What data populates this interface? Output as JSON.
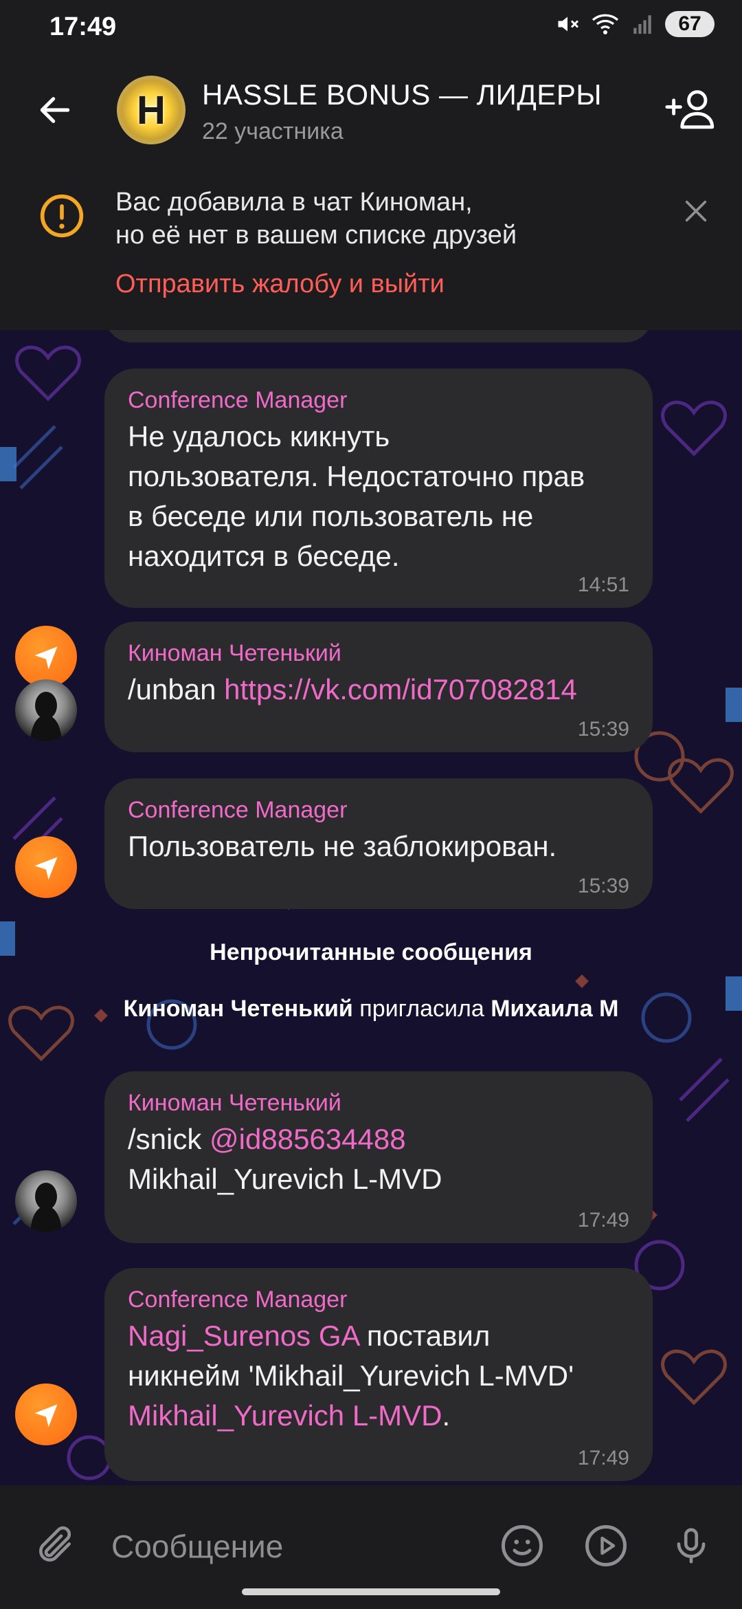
{
  "status_bar": {
    "time": "17:49",
    "battery": "67"
  },
  "header": {
    "title": "HASSLE BONUS — ЛИДЕРЫ",
    "subtitle": "22 участника",
    "avatar_letter": "H"
  },
  "notice": {
    "line1": "Вас добавила в чат Киноман,",
    "line2": "но её нет в вашем списке друзей",
    "action": "Отправить жалобу и выйти"
  },
  "messages": [
    {
      "sender": "Conference Manager",
      "lines": [
        "Не удалось кикнуть",
        "пользователя. Недостаточно прав",
        "в беседе или пользователь не",
        "находится в беседе."
      ],
      "time": "14:51"
    },
    {
      "sender": "Киноман Четенький",
      "text": "/unban ",
      "link": "https://vk.com/id707082814",
      "time": "15:39"
    },
    {
      "sender": "Conference Manager",
      "text": "Пользователь не заблокирован.",
      "time": "15:39"
    },
    {
      "sender": "Киноман Четенький",
      "text": "/snick ",
      "mention": "@id885634488",
      "line2": "Mikhail_Yurevich L-MVD",
      "time": "17:49"
    },
    {
      "sender": "Conference Manager",
      "mention1": "Nagi_Surenos GA",
      "text1": " поставил",
      "line2": "никнейм 'Mikhail_Yurevich L-MVD'",
      "mention2": "Mikhail_Yurevich L-MVD",
      "text2": ".",
      "time": "17:49"
    }
  ],
  "system": {
    "unread": "Непрочитанные сообщения",
    "invite_actor": "Киноман Четенький",
    "invite_verb": " пригласила ",
    "invite_target": "Михаила М"
  },
  "input": {
    "placeholder": "Сообщение"
  },
  "colors": {
    "accent_pink": "#f06bc9",
    "alert_red": "#ff5d57",
    "warning_orange": "#f5a623",
    "bot_orange": "#ff7a1a"
  }
}
